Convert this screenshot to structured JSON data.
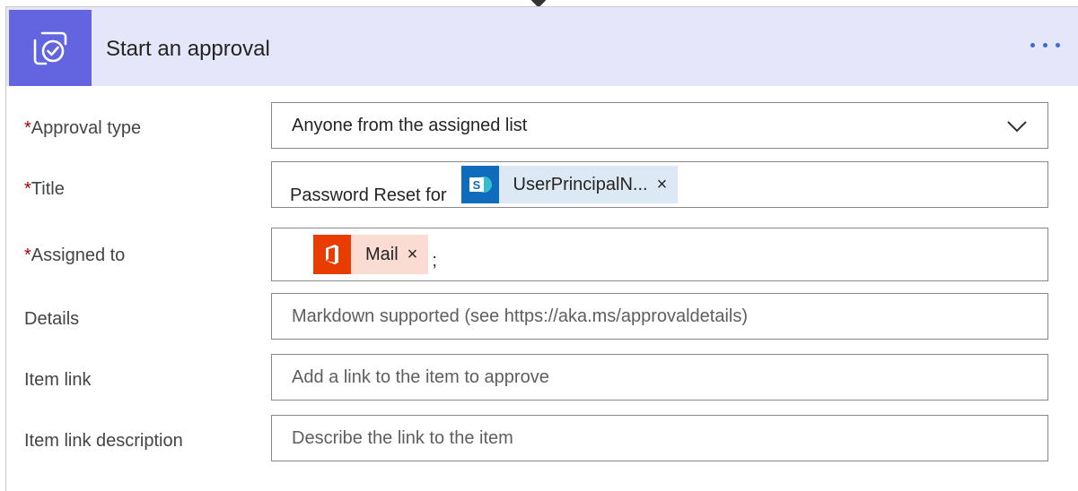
{
  "header": {
    "title": "Start an approval",
    "icon": "approval-check-icon",
    "accent": "#6264e0",
    "background": "#e6e6fa"
  },
  "required_mark": "*",
  "fields": {
    "approval_type": {
      "label": "Approval type",
      "value": "Anyone from the assigned list",
      "required": true
    },
    "title": {
      "label": "Title",
      "text_before": "Password Reset for",
      "token": {
        "text": "UserPrincipalN...",
        "icon": "sharepoint-icon",
        "color": "#0f6cbd",
        "bg": "#dce8f4"
      },
      "required": true
    },
    "assigned_to": {
      "label": "Assigned to",
      "token": {
        "text": "Mail",
        "icon": "office365-icon",
        "color": "#eb3c00",
        "bg": "#fbdcd3"
      },
      "text_after": ";",
      "required": true
    },
    "details": {
      "label": "Details",
      "placeholder": "Markdown supported (see https://aka.ms/approvaldetails)"
    },
    "item_link": {
      "label": "Item link",
      "placeholder": "Add a link to the item to approve"
    },
    "item_link_description": {
      "label": "Item link description",
      "placeholder": "Describe the link to the item"
    }
  },
  "token_remove_glyph": "×"
}
